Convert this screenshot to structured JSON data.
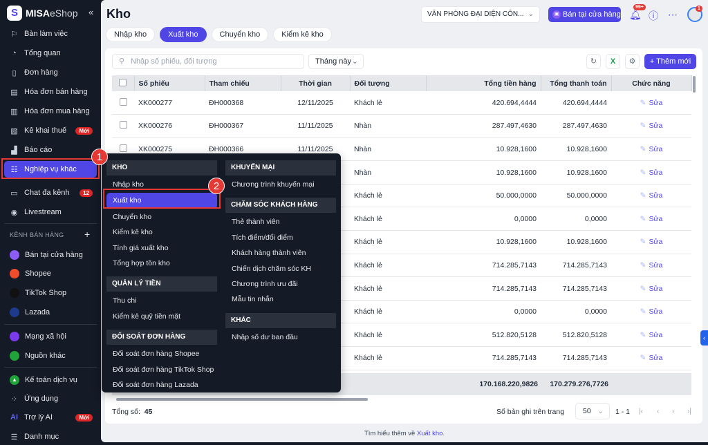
{
  "brand": {
    "name": "MISA",
    "suffix": "eShop",
    "collapse": "«"
  },
  "sidebar": {
    "items": [
      {
        "label": "Bàn làm việc",
        "icon": "⚐"
      },
      {
        "label": "Tổng quan",
        "icon": "◔"
      },
      {
        "label": "Đơn hàng",
        "icon": "▯"
      },
      {
        "label": "Hóa đơn bán hàng",
        "icon": "▤"
      },
      {
        "label": "Hóa đơn mua hàng",
        "icon": "▥"
      },
      {
        "label": "Kê khai thuế",
        "icon": "▧",
        "badge": "Mới"
      },
      {
        "label": "Báo cáo",
        "icon": "▟"
      },
      {
        "label": "Nghiệp vụ khác",
        "icon": "☷"
      },
      {
        "label": "Chat đa kênh",
        "icon": "▭",
        "badge": "12"
      },
      {
        "label": "Livestream",
        "icon": "◉"
      }
    ],
    "channels_label": "KÊNH BÁN HÀNG",
    "channels_plus": "+",
    "channels": [
      {
        "label": "Bán tại cửa hàng",
        "color": "#8b5cf6"
      },
      {
        "label": "Shopee",
        "color": "#ee4d2d"
      },
      {
        "label": "TikTok Shop",
        "color": "#111111"
      },
      {
        "label": "Lazada",
        "color": "#1e3a8a"
      }
    ],
    "social": [
      {
        "label": "Mạng xã hội",
        "color": "#7c3aed"
      },
      {
        "label": "Nguồn khác",
        "color": "#22a33a"
      }
    ],
    "bottom": [
      {
        "label": "Kế toán dịch vụ",
        "icon": "▲"
      },
      {
        "label": "Ứng dụng",
        "icon": "⁘"
      },
      {
        "label": "Trợ lý AI",
        "icon": "Ai",
        "badge": "Mới"
      },
      {
        "label": "Danh mục",
        "icon": "☰"
      }
    ]
  },
  "annotations": {
    "step1": "1",
    "step2": "2"
  },
  "header": {
    "title": "Kho",
    "branch": "VĂN PHÒNG ĐẠI DIỆN CÔN...",
    "sell_button": "Bán tại cửa hàng",
    "notif_badge": "99+",
    "avatar_badge": "1"
  },
  "tabs": [
    "Nhập kho",
    "Xuất kho",
    "Chuyển kho",
    "Kiểm kê kho"
  ],
  "toolbar": {
    "search_placeholder": "Nhập số phiếu, đối tượng",
    "period": "Tháng này",
    "add_button": "+ Thêm mới"
  },
  "table": {
    "columns": [
      "Số phiếu",
      "Tham chiếu",
      "Thời gian",
      "Đối tượng",
      "Tổng tiền hàng",
      "Tổng thanh toán",
      "Chức năng"
    ],
    "edit_label": "Sửa",
    "rows": [
      [
        "XK000277",
        "ĐH000368",
        "12/11/2025",
        "Khách lẻ",
        "420.694,4444",
        "420.694,4444"
      ],
      [
        "XK000276",
        "ĐH000367",
        "11/11/2025",
        "Nhàn",
        "287.497,4630",
        "287.497,4630"
      ],
      [
        "XK000275",
        "ĐH000366",
        "11/11/2025",
        "Nhàn",
        "10.928,1600",
        "10.928,1600"
      ],
      [
        "",
        "",
        "",
        "Nhàn",
        "10.928,1600",
        "10.928,1600"
      ],
      [
        "",
        "",
        "",
        "Khách lẻ",
        "50.000,0000",
        "50.000,0000"
      ],
      [
        "",
        "",
        "",
        "Khách lẻ",
        "0,0000",
        "0,0000"
      ],
      [
        "",
        "",
        "",
        "Khách lẻ",
        "10.928,1600",
        "10.928,1600"
      ],
      [
        "",
        "",
        "",
        "Khách lẻ",
        "714.285,7143",
        "714.285,7143"
      ],
      [
        "",
        "",
        "",
        "Khách lẻ",
        "714.285,7143",
        "714.285,7143"
      ],
      [
        "",
        "",
        "",
        "Khách lẻ",
        "0,0000",
        "0,0000"
      ],
      [
        "",
        "",
        "",
        "Khách lẻ",
        "512.820,5128",
        "512.820,5128"
      ],
      [
        "",
        "",
        "",
        "Khách lẻ",
        "714.285,7143",
        "714.285,7143"
      ]
    ],
    "total_goods": "170.168.220,9826",
    "total_payment": "170.279.276,7726"
  },
  "footer": {
    "total_label": "Tổng số:",
    "total_value": "45",
    "per_page_label": "Số bản ghi trên trang",
    "per_page": "50",
    "range": "1 - 1",
    "learn_text": "Tìm hiểu thêm về",
    "learn_link": "Xuất kho."
  },
  "menu": {
    "left": [
      {
        "header": "KHO",
        "items": [
          "Nhập kho",
          "Xuất kho",
          "Chuyển kho",
          "Kiểm kê kho",
          "Tính giá xuất kho",
          "Tổng hợp tồn kho"
        ]
      },
      {
        "header": "QUẢN LÝ TIỀN",
        "items": [
          "Thu chi",
          "Kiểm kê quỹ tiền mặt"
        ]
      },
      {
        "header": "ĐỐI SOÁT ĐƠN HÀNG",
        "items": [
          "Đối soát đơn hàng Shopee",
          "Đối soát đơn hàng TikTok Shop",
          "Đối soát đơn hàng Lazada"
        ]
      }
    ],
    "right": [
      {
        "header": "KHUYẾN MẠI",
        "items": [
          "Chương trình khuyến mại"
        ]
      },
      {
        "header": "CHĂM SÓC KHÁCH HÀNG",
        "items": [
          "Thẻ thành viên",
          "Tích điểm/đổi điểm",
          "Khách hàng thành viên",
          "Chiến dịch chăm sóc KH",
          "Chương trình ưu đãi",
          "Mẫu tin nhắn"
        ]
      },
      {
        "header": "KHÁC",
        "items": [
          "Nhập số dư ban đầu"
        ]
      }
    ],
    "active": "Xuất kho"
  }
}
